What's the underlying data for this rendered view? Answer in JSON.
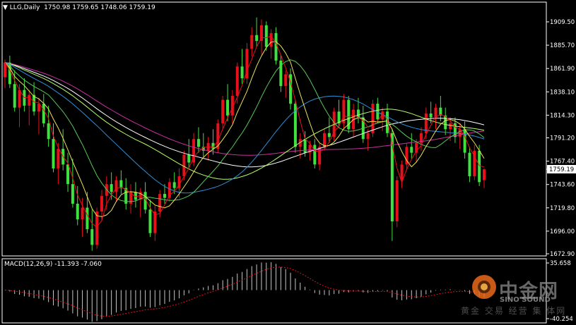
{
  "main_title": "LLG,Daily",
  "ohlc": {
    "open": "1750.98",
    "high": "1759.65",
    "low": "1748.06",
    "close": "1759.19"
  },
  "current_price_label": "1759.19",
  "macd_title": "MACD(12,26,9)",
  "macd_values": "-11.393 -7.060",
  "watermark": {
    "logo": "中金网",
    "sub": "SINO SOUND",
    "footer": "黄金 交易 经营 集 体网"
  },
  "colors": {
    "bull": "#e8101a",
    "bear": "#3fe13f",
    "grid": "#ffffff",
    "macd_hist": "#c8c8c8",
    "macd_signal": "#e8101a",
    "ma_white": "#ffffff",
    "ma_magenta": "#cc2fa3",
    "ma_lime": "#b5ff6a",
    "ma_blue": "#2e8fd8",
    "ma_green": "#57c957",
    "ma_yellow": "#ece25a",
    "ma_red": "#e8101a"
  },
  "chart_data": [
    {
      "type": "candlestick",
      "title": "LLG,Daily",
      "y_ticks": [
        "1909.50",
        "1885.70",
        "1861.90",
        "1838.10",
        "1814.30",
        "1791.20",
        "1767.40",
        "1743.60",
        "1719.80",
        "1696.00",
        "1672.90"
      ],
      "ylim": [
        1672.9,
        1914
      ],
      "current": 1759.19,
      "candles": [
        [
          1853,
          1871,
          1842,
          1868
        ],
        [
          1868,
          1875,
          1842,
          1846
        ],
        [
          1846,
          1860,
          1818,
          1822
        ],
        [
          1822,
          1846,
          1802,
          1840
        ],
        [
          1840,
          1852,
          1818,
          1824
        ],
        [
          1824,
          1840,
          1804,
          1835
        ],
        [
          1835,
          1848,
          1814,
          1818
        ],
        [
          1818,
          1832,
          1795,
          1826
        ],
        [
          1826,
          1836,
          1802,
          1806
        ],
        [
          1806,
          1824,
          1782,
          1790
        ],
        [
          1790,
          1806,
          1756,
          1760
        ],
        [
          1760,
          1786,
          1744,
          1780
        ],
        [
          1780,
          1800,
          1758,
          1764
        ],
        [
          1764,
          1776,
          1736,
          1744
        ],
        [
          1744,
          1770,
          1720,
          1724
        ],
        [
          1724,
          1742,
          1702,
          1708
        ],
        [
          1708,
          1730,
          1690,
          1720
        ],
        [
          1720,
          1736,
          1694,
          1698
        ],
        [
          1698,
          1718,
          1676,
          1682
        ],
        [
          1682,
          1720,
          1678,
          1716
        ],
        [
          1716,
          1738,
          1706,
          1732
        ],
        [
          1732,
          1752,
          1718,
          1744
        ],
        [
          1744,
          1756,
          1728,
          1736
        ],
        [
          1736,
          1752,
          1726,
          1748
        ],
        [
          1748,
          1758,
          1734,
          1740
        ],
        [
          1740,
          1750,
          1718,
          1724
        ],
        [
          1724,
          1744,
          1714,
          1736
        ],
        [
          1736,
          1746,
          1720,
          1728
        ],
        [
          1728,
          1740,
          1710,
          1736
        ],
        [
          1736,
          1746,
          1714,
          1718
        ],
        [
          1718,
          1728,
          1690,
          1694
        ],
        [
          1694,
          1722,
          1686,
          1716
        ],
        [
          1716,
          1738,
          1710,
          1734
        ],
        [
          1734,
          1744,
          1724,
          1730
        ],
        [
          1730,
          1750,
          1726,
          1746
        ],
        [
          1746,
          1756,
          1734,
          1740
        ],
        [
          1740,
          1760,
          1730,
          1752
        ],
        [
          1752,
          1778,
          1748,
          1774
        ],
        [
          1774,
          1790,
          1760,
          1766
        ],
        [
          1766,
          1796,
          1762,
          1790
        ],
        [
          1790,
          1802,
          1776,
          1782
        ],
        [
          1782,
          1796,
          1772,
          1778
        ],
        [
          1778,
          1792,
          1768,
          1786
        ],
        [
          1786,
          1800,
          1774,
          1780
        ],
        [
          1780,
          1810,
          1776,
          1806
        ],
        [
          1806,
          1834,
          1800,
          1830
        ],
        [
          1830,
          1846,
          1808,
          1814
        ],
        [
          1814,
          1840,
          1806,
          1834
        ],
        [
          1834,
          1868,
          1826,
          1864
        ],
        [
          1864,
          1882,
          1846,
          1852
        ],
        [
          1852,
          1888,
          1846,
          1882
        ],
        [
          1882,
          1904,
          1874,
          1896
        ],
        [
          1896,
          1914,
          1884,
          1890
        ],
        [
          1890,
          1912,
          1876,
          1906
        ],
        [
          1906,
          1910,
          1880,
          1884
        ],
        [
          1884,
          1902,
          1872,
          1898
        ],
        [
          1898,
          1904,
          1866,
          1870
        ],
        [
          1870,
          1876,
          1838,
          1844
        ],
        [
          1844,
          1860,
          1832,
          1856
        ],
        [
          1856,
          1862,
          1820,
          1826
        ],
        [
          1826,
          1830,
          1776,
          1782
        ],
        [
          1782,
          1796,
          1770,
          1790
        ],
        [
          1790,
          1798,
          1772,
          1776
        ],
        [
          1776,
          1788,
          1768,
          1784
        ],
        [
          1784,
          1790,
          1760,
          1764
        ],
        [
          1764,
          1786,
          1758,
          1782
        ],
        [
          1782,
          1800,
          1778,
          1796
        ],
        [
          1796,
          1812,
          1786,
          1792
        ],
        [
          1792,
          1822,
          1788,
          1818
        ],
        [
          1818,
          1830,
          1802,
          1806
        ],
        [
          1806,
          1836,
          1800,
          1830
        ],
        [
          1830,
          1834,
          1796,
          1800
        ],
        [
          1800,
          1826,
          1792,
          1820
        ],
        [
          1820,
          1832,
          1806,
          1812
        ],
        [
          1812,
          1824,
          1786,
          1790
        ],
        [
          1790,
          1800,
          1778,
          1796
        ],
        [
          1796,
          1830,
          1792,
          1826
        ],
        [
          1826,
          1832,
          1806,
          1810
        ],
        [
          1810,
          1822,
          1798,
          1818
        ],
        [
          1818,
          1826,
          1792,
          1796
        ],
        [
          1796,
          1800,
          1686,
          1706
        ],
        [
          1706,
          1752,
          1700,
          1748
        ],
        [
          1748,
          1768,
          1740,
          1764
        ],
        [
          1764,
          1786,
          1758,
          1782
        ],
        [
          1782,
          1796,
          1770,
          1776
        ],
        [
          1776,
          1790,
          1766,
          1786
        ],
        [
          1786,
          1802,
          1778,
          1796
        ],
        [
          1796,
          1822,
          1790,
          1816
        ],
        [
          1816,
          1828,
          1806,
          1812
        ],
        [
          1812,
          1826,
          1800,
          1822
        ],
        [
          1822,
          1834,
          1808,
          1814
        ],
        [
          1814,
          1822,
          1794,
          1800
        ],
        [
          1800,
          1812,
          1788,
          1806
        ],
        [
          1806,
          1812,
          1786,
          1792
        ],
        [
          1792,
          1806,
          1780,
          1800
        ],
        [
          1800,
          1808,
          1770,
          1776
        ],
        [
          1776,
          1782,
          1746,
          1752
        ],
        [
          1752,
          1784,
          1748,
          1778
        ],
        [
          1778,
          1784,
          1742,
          1746
        ],
        [
          1748,
          1760,
          1740,
          1759
        ]
      ]
    },
    {
      "type": "macd",
      "title": "MACD(12,26,9)",
      "y_ticks": [
        "35.658",
        "-40.254"
      ],
      "ylim": [
        -40.254,
        35.658
      ],
      "macd": -11.393,
      "signal": -7.06
    }
  ]
}
